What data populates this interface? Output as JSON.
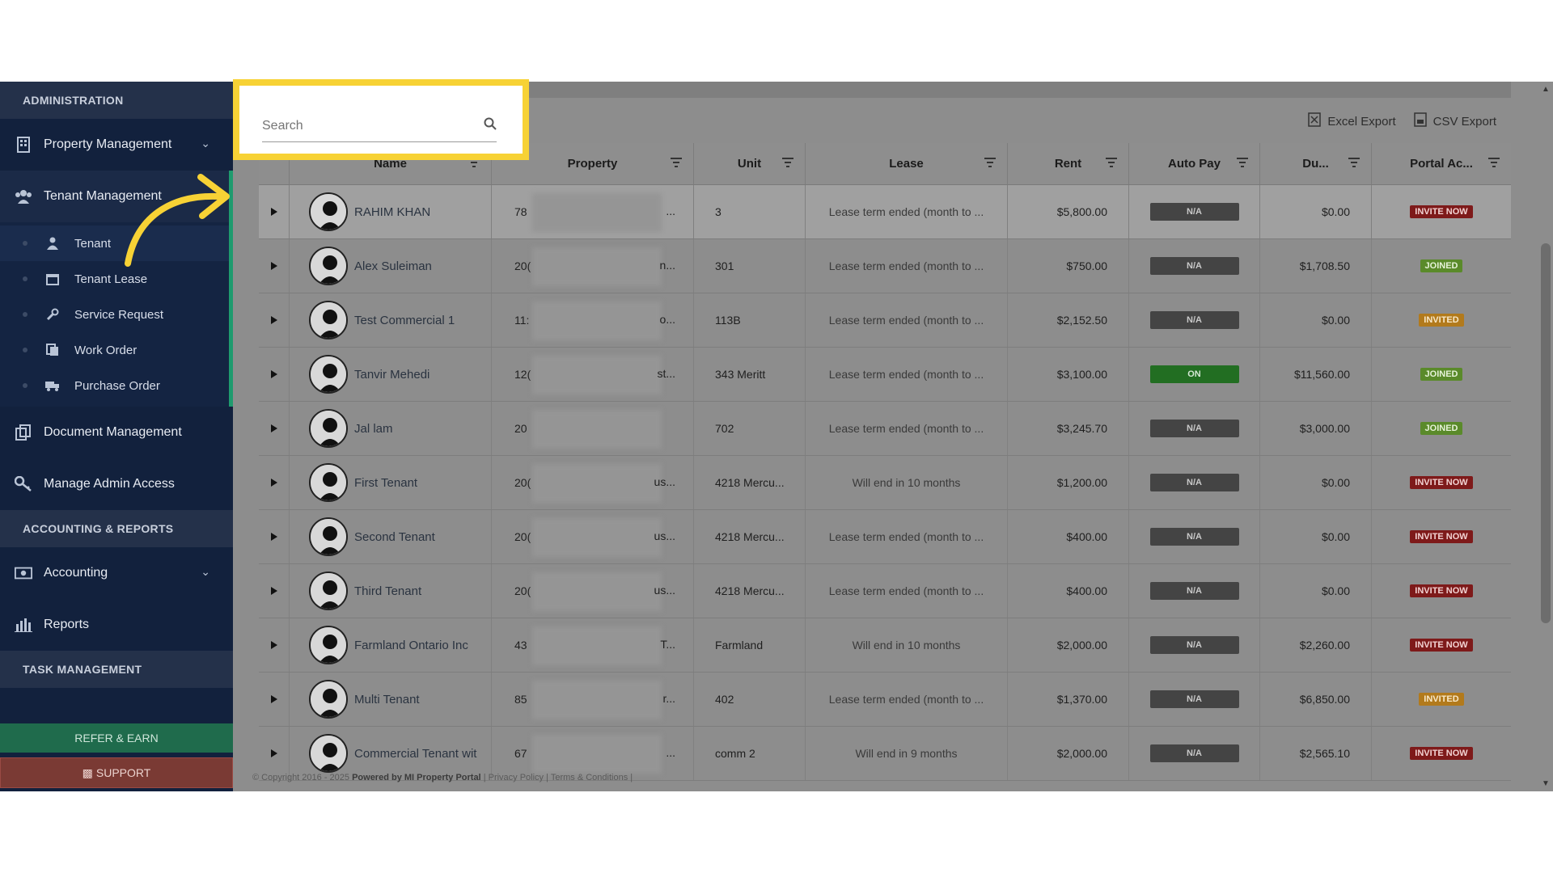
{
  "sidebar": {
    "section_admin": "ADMINISTRATION",
    "property_management": "Property Management",
    "tenant_management": "Tenant Management",
    "sub": {
      "tenant": "Tenant",
      "tenant_lease": "Tenant Lease",
      "service_request": "Service Request",
      "work_order": "Work Order",
      "purchase_order": "Purchase Order"
    },
    "document_management": "Document Management",
    "manage_admin_access": "Manage Admin Access",
    "section_accounting": "ACCOUNTING & REPORTS",
    "accounting": "Accounting",
    "reports": "Reports",
    "section_task": "TASK MANAGEMENT",
    "refer_earn": "REFER & EARN",
    "support": "SUPPORT"
  },
  "toolbar": {
    "search_placeholder": "Search",
    "excel_export": "Excel Export",
    "csv_export": "CSV Export"
  },
  "columns": {
    "name": "Name",
    "property": "Property",
    "unit": "Unit",
    "lease": "Lease",
    "rent": "Rent",
    "auto_pay": "Auto Pay",
    "due": "Du...",
    "portal": "Portal Ac..."
  },
  "rows": [
    {
      "name": "RAHIM KHAN",
      "prop_prefix": "78",
      "prop_suffix": "...",
      "unit": "3",
      "lease": "Lease term ended (month to ...",
      "rent": "$5,800.00",
      "auto": "N/A",
      "due": "$0.00",
      "portal": "INVITE NOW"
    },
    {
      "name": "Alex Suleiman",
      "prop_prefix": "20(",
      "prop_suffix": "n...",
      "unit": "301",
      "lease": "Lease term ended (month to ...",
      "rent": "$750.00",
      "auto": "N/A",
      "due": "$1,708.50",
      "portal": "JOINED"
    },
    {
      "name": "Test Commercial 1",
      "prop_prefix": "11:",
      "prop_suffix": "o...",
      "unit": "113B",
      "lease": "Lease term ended (month to ...",
      "rent": "$2,152.50",
      "auto": "N/A",
      "due": "$0.00",
      "portal": "INVITED"
    },
    {
      "name": "Tanvir Mehedi",
      "prop_prefix": "12(",
      "prop_suffix": "st...",
      "unit": "343 Meritt",
      "lease": "Lease term ended (month to ...",
      "rent": "$3,100.00",
      "auto": "ON",
      "due": "$11,560.00",
      "portal": "JOINED"
    },
    {
      "name": "Jal        lam",
      "prop_prefix": "20",
      "prop_suffix": "",
      "unit": "702",
      "lease": "Lease term ended (month to ...",
      "rent": "$3,245.70",
      "auto": "N/A",
      "due": "$3,000.00",
      "portal": "JOINED"
    },
    {
      "name": "First Tenant",
      "prop_prefix": "20(",
      "prop_suffix": "us...",
      "unit": "4218 Mercu...",
      "lease": "Will end in 10 months",
      "rent": "$1,200.00",
      "auto": "N/A",
      "due": "$0.00",
      "portal": "INVITE NOW"
    },
    {
      "name": "Second Tenant",
      "prop_prefix": "20(",
      "prop_suffix": "us...",
      "unit": "4218 Mercu...",
      "lease": "Lease term ended (month to ...",
      "rent": "$400.00",
      "auto": "N/A",
      "due": "$0.00",
      "portal": "INVITE NOW"
    },
    {
      "name": "Third Tenant",
      "prop_prefix": "20(",
      "prop_suffix": "us...",
      "unit": "4218 Mercu...",
      "lease": "Lease term ended (month to ...",
      "rent": "$400.00",
      "auto": "N/A",
      "due": "$0.00",
      "portal": "INVITE NOW"
    },
    {
      "name": "Farmland Ontario Inc",
      "prop_prefix": "43",
      "prop_suffix": "T...",
      "unit": "Farmland",
      "lease": "Will end in 10 months",
      "rent": "$2,000.00",
      "auto": "N/A",
      "due": "$2,260.00",
      "portal": "INVITE NOW"
    },
    {
      "name": "Multi Tenant",
      "prop_prefix": "85",
      "prop_suffix": "r...",
      "unit": "402",
      "lease": "Lease term ended (month to ...",
      "rent": "$1,370.00",
      "auto": "N/A",
      "due": "$6,850.00",
      "portal": "INVITED"
    },
    {
      "name": "Commercial Tenant wit",
      "prop_prefix": "67",
      "prop_suffix": "...",
      "unit": "comm 2",
      "lease": "Will end in 9 months",
      "rent": "$2,000.00",
      "auto": "N/A",
      "due": "$2,565.10",
      "portal": "INVITE NOW"
    }
  ],
  "footer": {
    "copyright": "© Copyright 2016 - 2025",
    "powered": "Powered by MI Property Portal",
    "links": "| Privacy Policy | Terms & Conditions |"
  },
  "colors": {
    "highlight": "#f7d235",
    "sidebar": "#12213d",
    "accent_green": "#1f9b6e"
  }
}
